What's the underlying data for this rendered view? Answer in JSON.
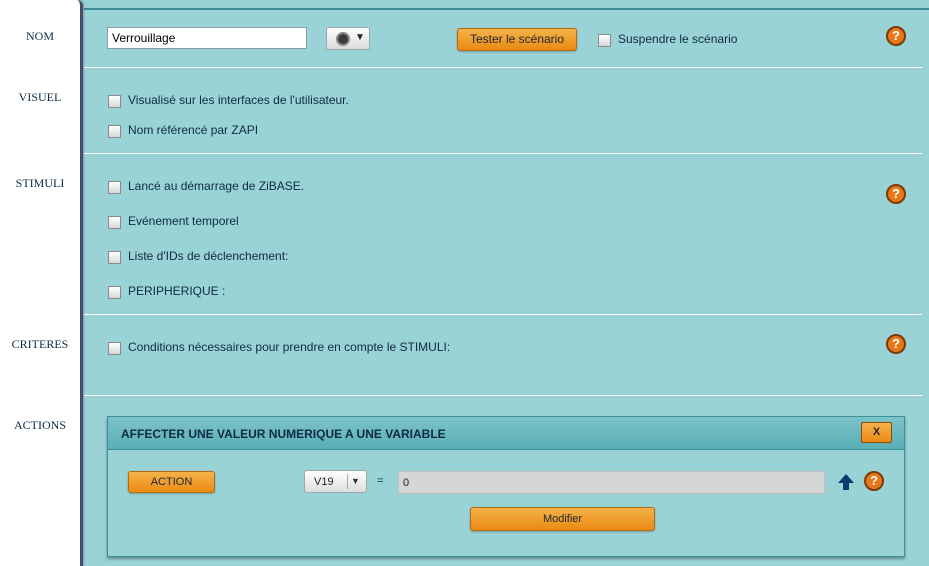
{
  "sections": {
    "nom": "NOM",
    "visuel": "VISUEL",
    "stimuli": "STIMULI",
    "criteres": "CRITERES",
    "actions": "ACTIONS"
  },
  "nom": {
    "name_value": "Verrouillage",
    "test_button": "Tester le scénario",
    "suspend_label": "Suspendre le scénario",
    "help": "?"
  },
  "visuel": {
    "options": [
      "Visualisé sur les interfaces de l'utilisateur.",
      "Nom référencé par ZAPI"
    ]
  },
  "stimuli": {
    "options": [
      "Lancé au démarrage de ZiBASE.",
      "Evénement temporel",
      "Liste d'IDs de déclenchement:",
      "PERIPHERIQUE :"
    ],
    "help": "?"
  },
  "criteres": {
    "condition_label": "Conditions nécessaires pour prendre en compte le STIMULI:",
    "help": "?"
  },
  "actions": {
    "panel_title": "AFFECTER UNE VALEUR NUMERIQUE A UNE VARIABLE",
    "close_label": "X",
    "action_button": "ACTION",
    "variable_selected": "V19",
    "equals": "=",
    "value": "0",
    "modify_button": "Modifier",
    "help": "?"
  },
  "colors": {
    "background": "#9ad3d6",
    "accent_orange": "#ea8a12",
    "text": "#0e2a44"
  }
}
